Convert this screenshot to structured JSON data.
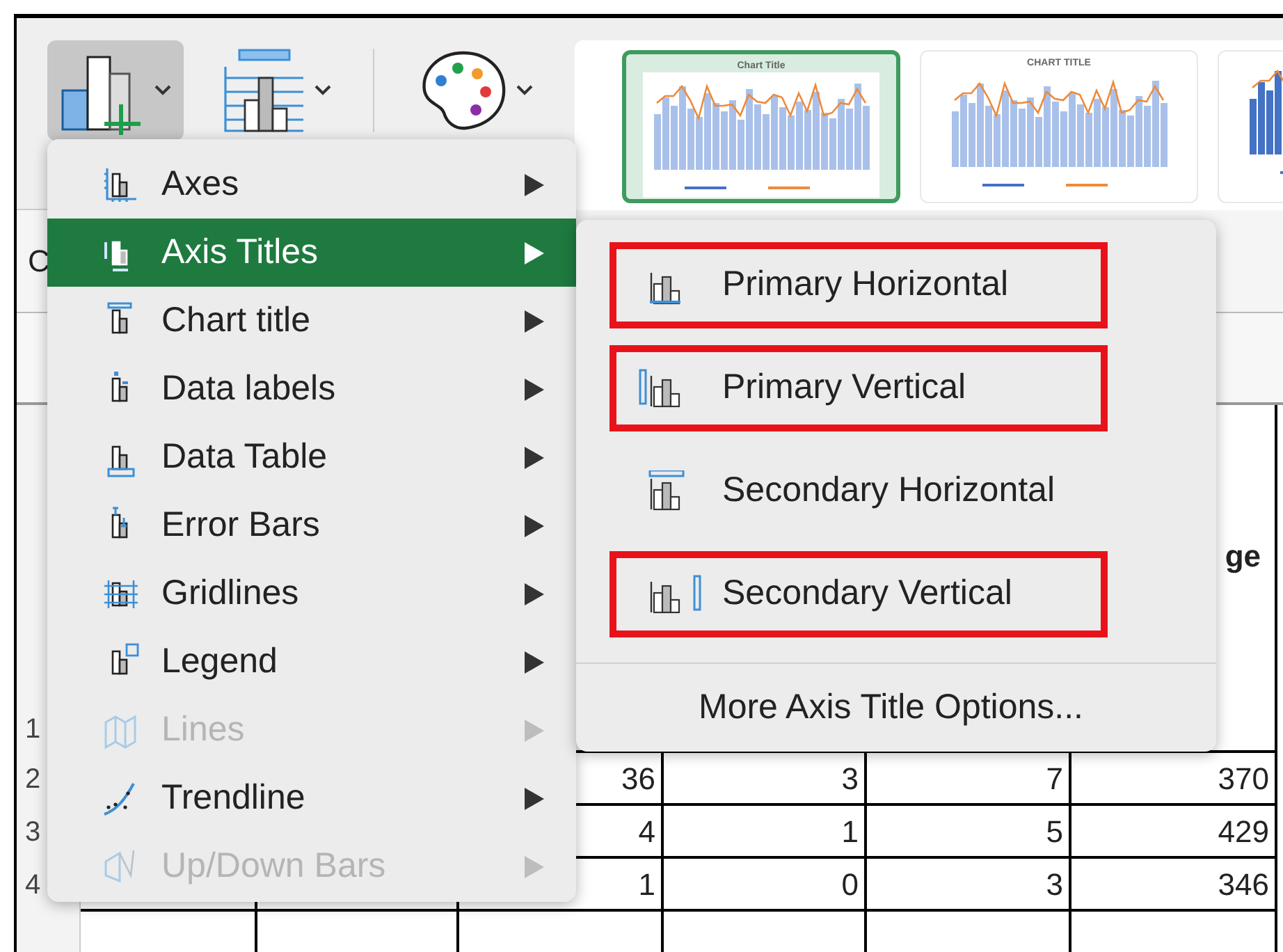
{
  "toolbar": {
    "buttons": [
      {
        "kind": "add-chart-element",
        "selected": true
      },
      {
        "kind": "quick-layout",
        "selected": false
      },
      {
        "kind": "change-colors",
        "selected": false
      }
    ],
    "gallery": [
      {
        "title": "Chart Title",
        "selected": true
      },
      {
        "title": "CHART TITLE",
        "selected": false
      },
      {
        "selected": false
      }
    ]
  },
  "formula_band": {
    "cell_label": "C"
  },
  "sheet": {
    "rows": [
      {
        "number": "1",
        "cells": {
          "column_6": "ge"
        }
      },
      {
        "number": "2",
        "cells": {
          "column_3": "36",
          "column_4": "3",
          "column_5": "7",
          "column_6": "370"
        }
      },
      {
        "number": "3",
        "cells": {
          "column_3": "4",
          "column_4": "1",
          "column_5": "5",
          "column_6": "429"
        }
      },
      {
        "number": "4",
        "cells": {
          "column_3": "1",
          "column_4": "0",
          "column_5": "3",
          "column_6": "346"
        }
      }
    ]
  },
  "menu": {
    "items": [
      {
        "label": "Axes",
        "kind": "axes",
        "selected": false,
        "disabled": false
      },
      {
        "label": "Axis Titles",
        "kind": "axis-titles",
        "selected": true,
        "disabled": false
      },
      {
        "label": "Chart title",
        "kind": "chart-title",
        "selected": false,
        "disabled": false
      },
      {
        "label": "Data labels",
        "kind": "data-labels",
        "selected": false,
        "disabled": false
      },
      {
        "label": "Data Table",
        "kind": "data-table",
        "selected": false,
        "disabled": false
      },
      {
        "label": "Error Bars",
        "kind": "error-bars",
        "selected": false,
        "disabled": false
      },
      {
        "label": "Gridlines",
        "kind": "gridlines",
        "selected": false,
        "disabled": false
      },
      {
        "label": "Legend",
        "kind": "legend",
        "selected": false,
        "disabled": false
      },
      {
        "label": "Lines",
        "kind": "lines",
        "selected": false,
        "disabled": true
      },
      {
        "label": "Trendline",
        "kind": "trendline",
        "selected": false,
        "disabled": false
      },
      {
        "label": "Up/Down Bars",
        "kind": "updown",
        "selected": false,
        "disabled": true
      }
    ]
  },
  "submenu": {
    "items": [
      {
        "label": "Primary Horizontal",
        "kind": "primary-horizontal",
        "highlighted": true
      },
      {
        "label": "Primary Vertical",
        "kind": "primary-vertical",
        "highlighted": true
      },
      {
        "label": "Secondary Horizontal",
        "kind": "secondary-horizontal",
        "highlighted": false
      },
      {
        "label": "Secondary Vertical",
        "kind": "secondary-vertical",
        "highlighted": true
      }
    ],
    "footer_item": "More Axis Title Options..."
  }
}
